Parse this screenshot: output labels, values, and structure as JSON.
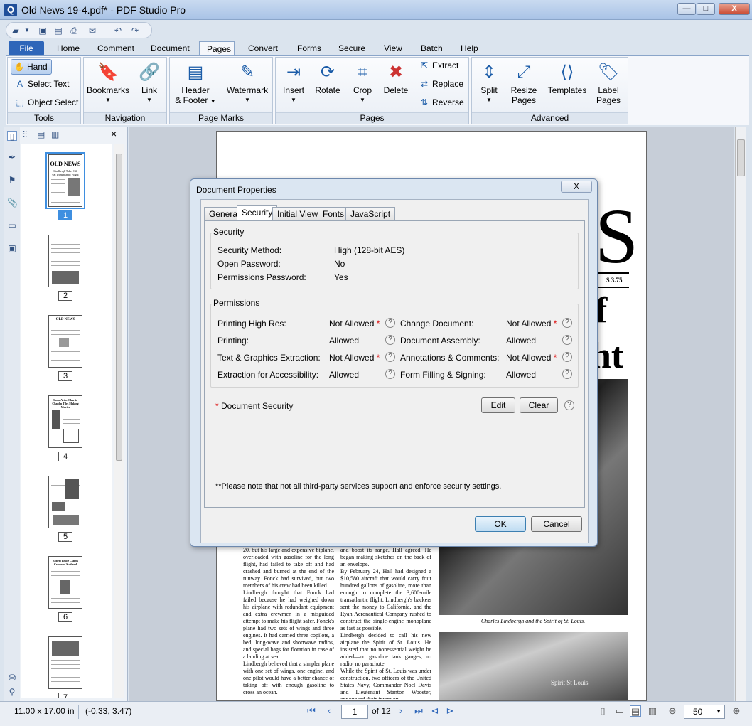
{
  "window": {
    "title": "Old News 19-4.pdf* - PDF Studio Pro",
    "min": "—",
    "max": "□",
    "close": "X"
  },
  "menu": [
    "File",
    "Home",
    "Comment",
    "Document",
    "Pages",
    "Convert",
    "Forms",
    "Secure",
    "View",
    "Batch",
    "Help"
  ],
  "ribbon": {
    "tools": {
      "label": "Tools",
      "hand": "Hand",
      "select_text": "Select Text",
      "object_select": "Object Select"
    },
    "navigation": {
      "label": "Navigation",
      "bookmarks": "Bookmarks",
      "link": "Link"
    },
    "page_marks": {
      "label": "Page Marks",
      "header_footer_1": "Header",
      "header_footer_2": "& Footer",
      "watermark": "Watermark"
    },
    "pages": {
      "label": "Pages",
      "insert": "Insert",
      "rotate": "Rotate",
      "crop": "Crop",
      "delete": "Delete",
      "extract": "Extract",
      "replace": "Replace",
      "reverse": "Reverse"
    },
    "advanced": {
      "label": "Advanced",
      "split": "Split",
      "resize_1": "Resize",
      "resize_2": "Pages",
      "templates": "Templates",
      "label_1": "Label",
      "label_2": "Pages"
    }
  },
  "side_panel": {
    "close": "×",
    "thumbnails": [
      "1",
      "2",
      "3",
      "4",
      "5",
      "6",
      "7"
    ]
  },
  "thumb_text": {
    "t1_title": "OLD NEWS",
    "t1_sub1": "Lindbergh Takes Off",
    "t1_sub2": "On Transatlantic Flight",
    "t3_title": "OLD NEWS",
    "t4_title": "Some Actor Charlie Chaplin Tiles Making Movies",
    "t6_title": "Robert Bruce Claims Crown of Scotland"
  },
  "pdf_page": {
    "big_s": "S",
    "price": "$ 3.75",
    "big_f": "f",
    "big_ht": "ht",
    "col1": "20, but his large and expensive biplane, overloaded with gasoline for the long flight, had failed to take off and had crashed and burned at the end of the runway. Fonck had survived, but two members of his crew had been killed.\n   Lindbergh thought that Fonck had failed because he had weighed down his airplane with redundant equipment and extra crewmen in a misguided attempt to make his flight safer. Fonck's plane had two sets of wings and three engines. It had carried three copilots, a bed, long-wave and shortwave radios, and special bags for flotation in case of a landing at sea.\n   Lindbergh believed that a simpler plane with one set of wings, one engine, and one pilot would have a better chance of taking off with enough gasoline to cross an ocean.",
    "col2": "and boost its range, Hall agreed. He began making sketches on the back of an envelope.\n   By February 24, Hall had designed a $10,580 aircraft that would carry four hundred gallons of gasoline, more than enough to complete the 3,600-mile transatlantic flight. Lindbergh's backers sent the money to California, and the Ryan Aeronautical Company rushed to construct the single-engine monoplane as fast as possible.\n   Lindbergh decided to call his new airplane the Spirit of St. Louis. He insisted that no nonessential weight be added—no gasoline tank gauges, no radio, no parachute.\n   While the Spirit of St. Louis was under construction, two officers of the United States Navy, Commander Noel Davis and Lieutenant Stanton Wooster, announced their intention",
    "caption": "Charles Lindbergh and the Spirit of St. Louis.",
    "plane_text": "Spirit St Louis"
  },
  "dialog": {
    "title": "Document Properties",
    "close": "X",
    "tabs": [
      "General",
      "Security",
      "Initial View",
      "Fonts",
      "JavaScript"
    ],
    "security_legend": "Security",
    "security_rows": [
      {
        "k": "Security Method:",
        "v": "High (128-bit AES)"
      },
      {
        "k": "Open Password:",
        "v": "No"
      },
      {
        "k": "Permissions Password:",
        "v": "Yes"
      }
    ],
    "permissions_legend": "Permissions",
    "perm_left": [
      {
        "k": "Printing High Res:",
        "v": "Not Allowed",
        "star": "*"
      },
      {
        "k": "Printing:",
        "v": "Allowed",
        "star": ""
      },
      {
        "k": "Text & Graphics Extraction:",
        "v": "Not Allowed",
        "star": "*"
      },
      {
        "k": "Extraction for Accessibility:",
        "v": "Allowed",
        "star": ""
      }
    ],
    "perm_right": [
      {
        "k": "Change Document:",
        "v": "Not Allowed",
        "star": "*"
      },
      {
        "k": "Document Assembly:",
        "v": "Allowed",
        "star": ""
      },
      {
        "k": "Annotations & Comments:",
        "v": "Not Allowed",
        "star": "*"
      },
      {
        "k": "Form Filling & Signing:",
        "v": "Allowed",
        "star": ""
      }
    ],
    "doc_security_star": "*",
    "doc_security": "Document Security",
    "edit": "Edit",
    "clear": "Clear",
    "help": "?",
    "note": "**Please note that not all third-party services support and enforce security settings.",
    "ok": "OK",
    "cancel": "Cancel"
  },
  "status": {
    "size": "11.00 x 17.00 in",
    "coords": "(-0.33, 3.47)",
    "page": "1",
    "of": "of 12",
    "zoom": "50"
  }
}
